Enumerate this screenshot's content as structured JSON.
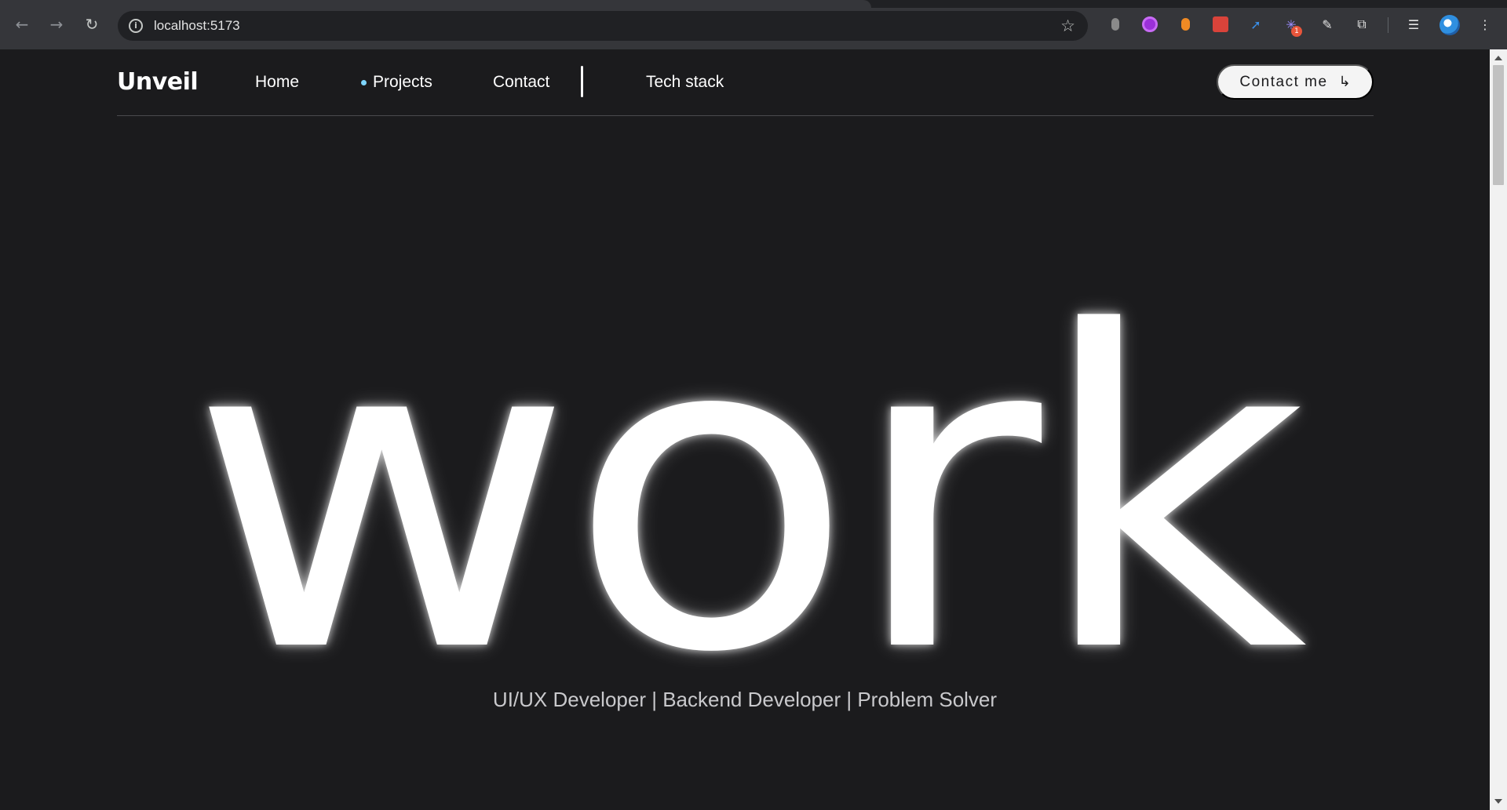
{
  "browser": {
    "url": "localhost:5173",
    "extension_badge_count": "1",
    "icons": {
      "back": "arrow-left-icon",
      "forward": "arrow-right-icon",
      "reload": "reload-icon",
      "site_info": "info-icon",
      "bookmark": "star-icon",
      "extensions": "puzzle-icon",
      "reading_list": "list-icon",
      "menu": "kebab-menu-icon"
    }
  },
  "site": {
    "brand": "Unveil",
    "nav": [
      {
        "label": "Home"
      },
      {
        "label": "Projects",
        "active": true
      },
      {
        "label": "Contact"
      },
      {
        "label": "Tech stack"
      }
    ],
    "cta_label": "Contact me",
    "cta_icon": "↳",
    "hero_word": "work",
    "tagline": "UI/UX Developer | Backend Developer | Problem Solver",
    "colors": {
      "background": "#1b1b1d",
      "text": "#ffffff",
      "active_dot": "#7fd6ff",
      "cta_bg": "#f4f4f4"
    }
  }
}
